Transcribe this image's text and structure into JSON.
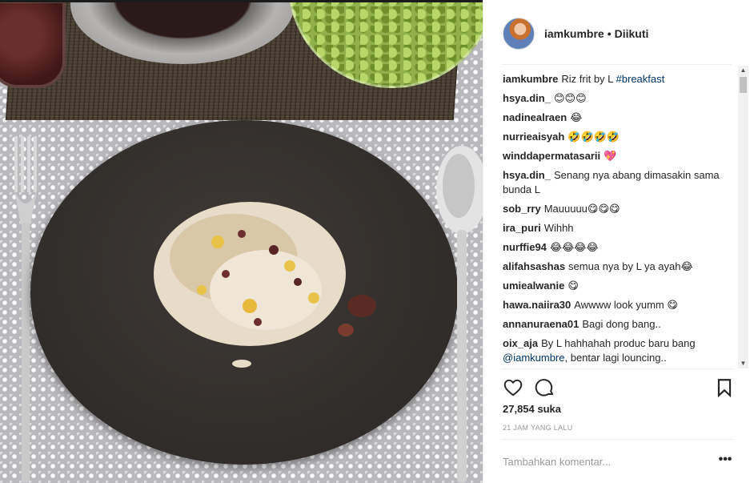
{
  "post": {
    "username": "iamkumbre",
    "separator": "•",
    "follow_status": "Diikuti"
  },
  "comments": [
    {
      "user": "iamkumbre",
      "text": "Riz frit by L",
      "tag": "#breakfast"
    },
    {
      "user": "hsya.din_",
      "text": "😊😊😊"
    },
    {
      "user": "nadinealraen",
      "text": "😂"
    },
    {
      "user": "nurrieaisyah",
      "text": "🤣🤣🤣🤣"
    },
    {
      "user": "winddapermatasarii",
      "text": "💖"
    },
    {
      "user": "hsya.din_",
      "text": "Senang nya abang dimasakin sama bunda L"
    },
    {
      "user": "sob_rry",
      "text": "Mauuuuu😋😋😋"
    },
    {
      "user": "ira_puri",
      "text": "Wihhh"
    },
    {
      "user": "nurffie94",
      "text": "😂😂😂😂"
    },
    {
      "user": "alifahsashas",
      "text": "semua nya by L ya ayah😂"
    },
    {
      "user": "umiealwanie",
      "text": "😋"
    },
    {
      "user": "hawa.naiira30",
      "text": "Awwww look yumm 😋"
    },
    {
      "user": "annanuraena01",
      "text": "Bagi dong bang.."
    },
    {
      "user": "oix_aja",
      "text": "By L hahhahah produc baru bang",
      "mention": "@iamkumbre",
      "text_after": ", bentar lagi louncing.."
    }
  ],
  "likes": "27,854 suka",
  "timestamp": "21 JAM YANG LALU",
  "comment_input": {
    "placeholder": "Tambahkan komentar...",
    "value": ""
  },
  "more_label": "•••",
  "icons": {
    "like": "heart-icon",
    "comment": "comment-icon",
    "save": "bookmark-icon"
  },
  "colors": {
    "text": "#262626",
    "link": "#003569",
    "muted": "#999999",
    "divider": "#efefef"
  }
}
